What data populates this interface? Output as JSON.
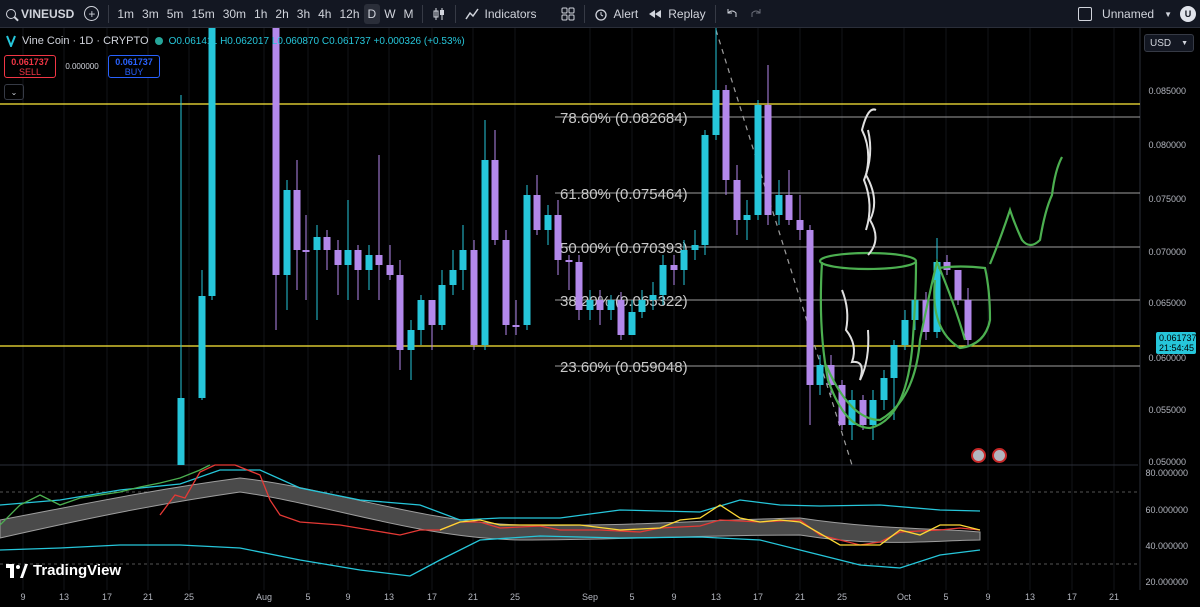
{
  "toolbar": {
    "symbol": "VINEUSD",
    "timeframes": [
      "1m",
      "3m",
      "5m",
      "15m",
      "30m",
      "1h",
      "2h",
      "3h",
      "4h",
      "12h",
      "D",
      "W",
      "M"
    ],
    "active_timeframe": "D",
    "indicators_label": "Indicators",
    "alert_label": "Alert",
    "replay_label": "Replay",
    "layout_name": "Unnamed",
    "avatar_letter": "U"
  },
  "legend": {
    "title": "Vine Coin · 1D · CRYPTO",
    "ohlc": "O0.061411 H0.062017 L0.060870 C0.061737 +0.000326 (+0.53%)"
  },
  "trade": {
    "sell_price": "0.061737",
    "sell_label": "SELL",
    "spread": "0.000000",
    "buy_price": "0.061737",
    "buy_label": "BUY"
  },
  "axis": {
    "currency": "USD",
    "price_ticks": [
      "0.085000",
      "0.080000",
      "0.075000",
      "0.070000",
      "0.065000",
      "0.060000",
      "0.055000",
      "0.050000"
    ],
    "current_price": "0.061737",
    "countdown": "21:54:45",
    "rsi_ticks": [
      "80.000000",
      "60.000000",
      "40.000000",
      "20.000000"
    ],
    "date_ticks": [
      "9",
      "13",
      "17",
      "21",
      "25",
      "Aug",
      "5",
      "9",
      "13",
      "17",
      "21",
      "25",
      "Sep",
      "5",
      "9",
      "13",
      "17",
      "21",
      "25",
      "Oct",
      "5",
      "9",
      "13",
      "17",
      "21"
    ]
  },
  "fib": [
    {
      "label": "78.60% (0.082684)"
    },
    {
      "label": "61.80% (0.075464)"
    },
    {
      "label": "50.00% (0.070393)"
    },
    {
      "label": "38.20% (0.065322)"
    },
    {
      "label": "23.60% (0.059048)"
    }
  ],
  "branding": "TradingView",
  "colors": {
    "up": "#26c6da",
    "down": "#b388eb",
    "hline": "#ffeb3b",
    "drawing_green": "#4caf50"
  }
}
